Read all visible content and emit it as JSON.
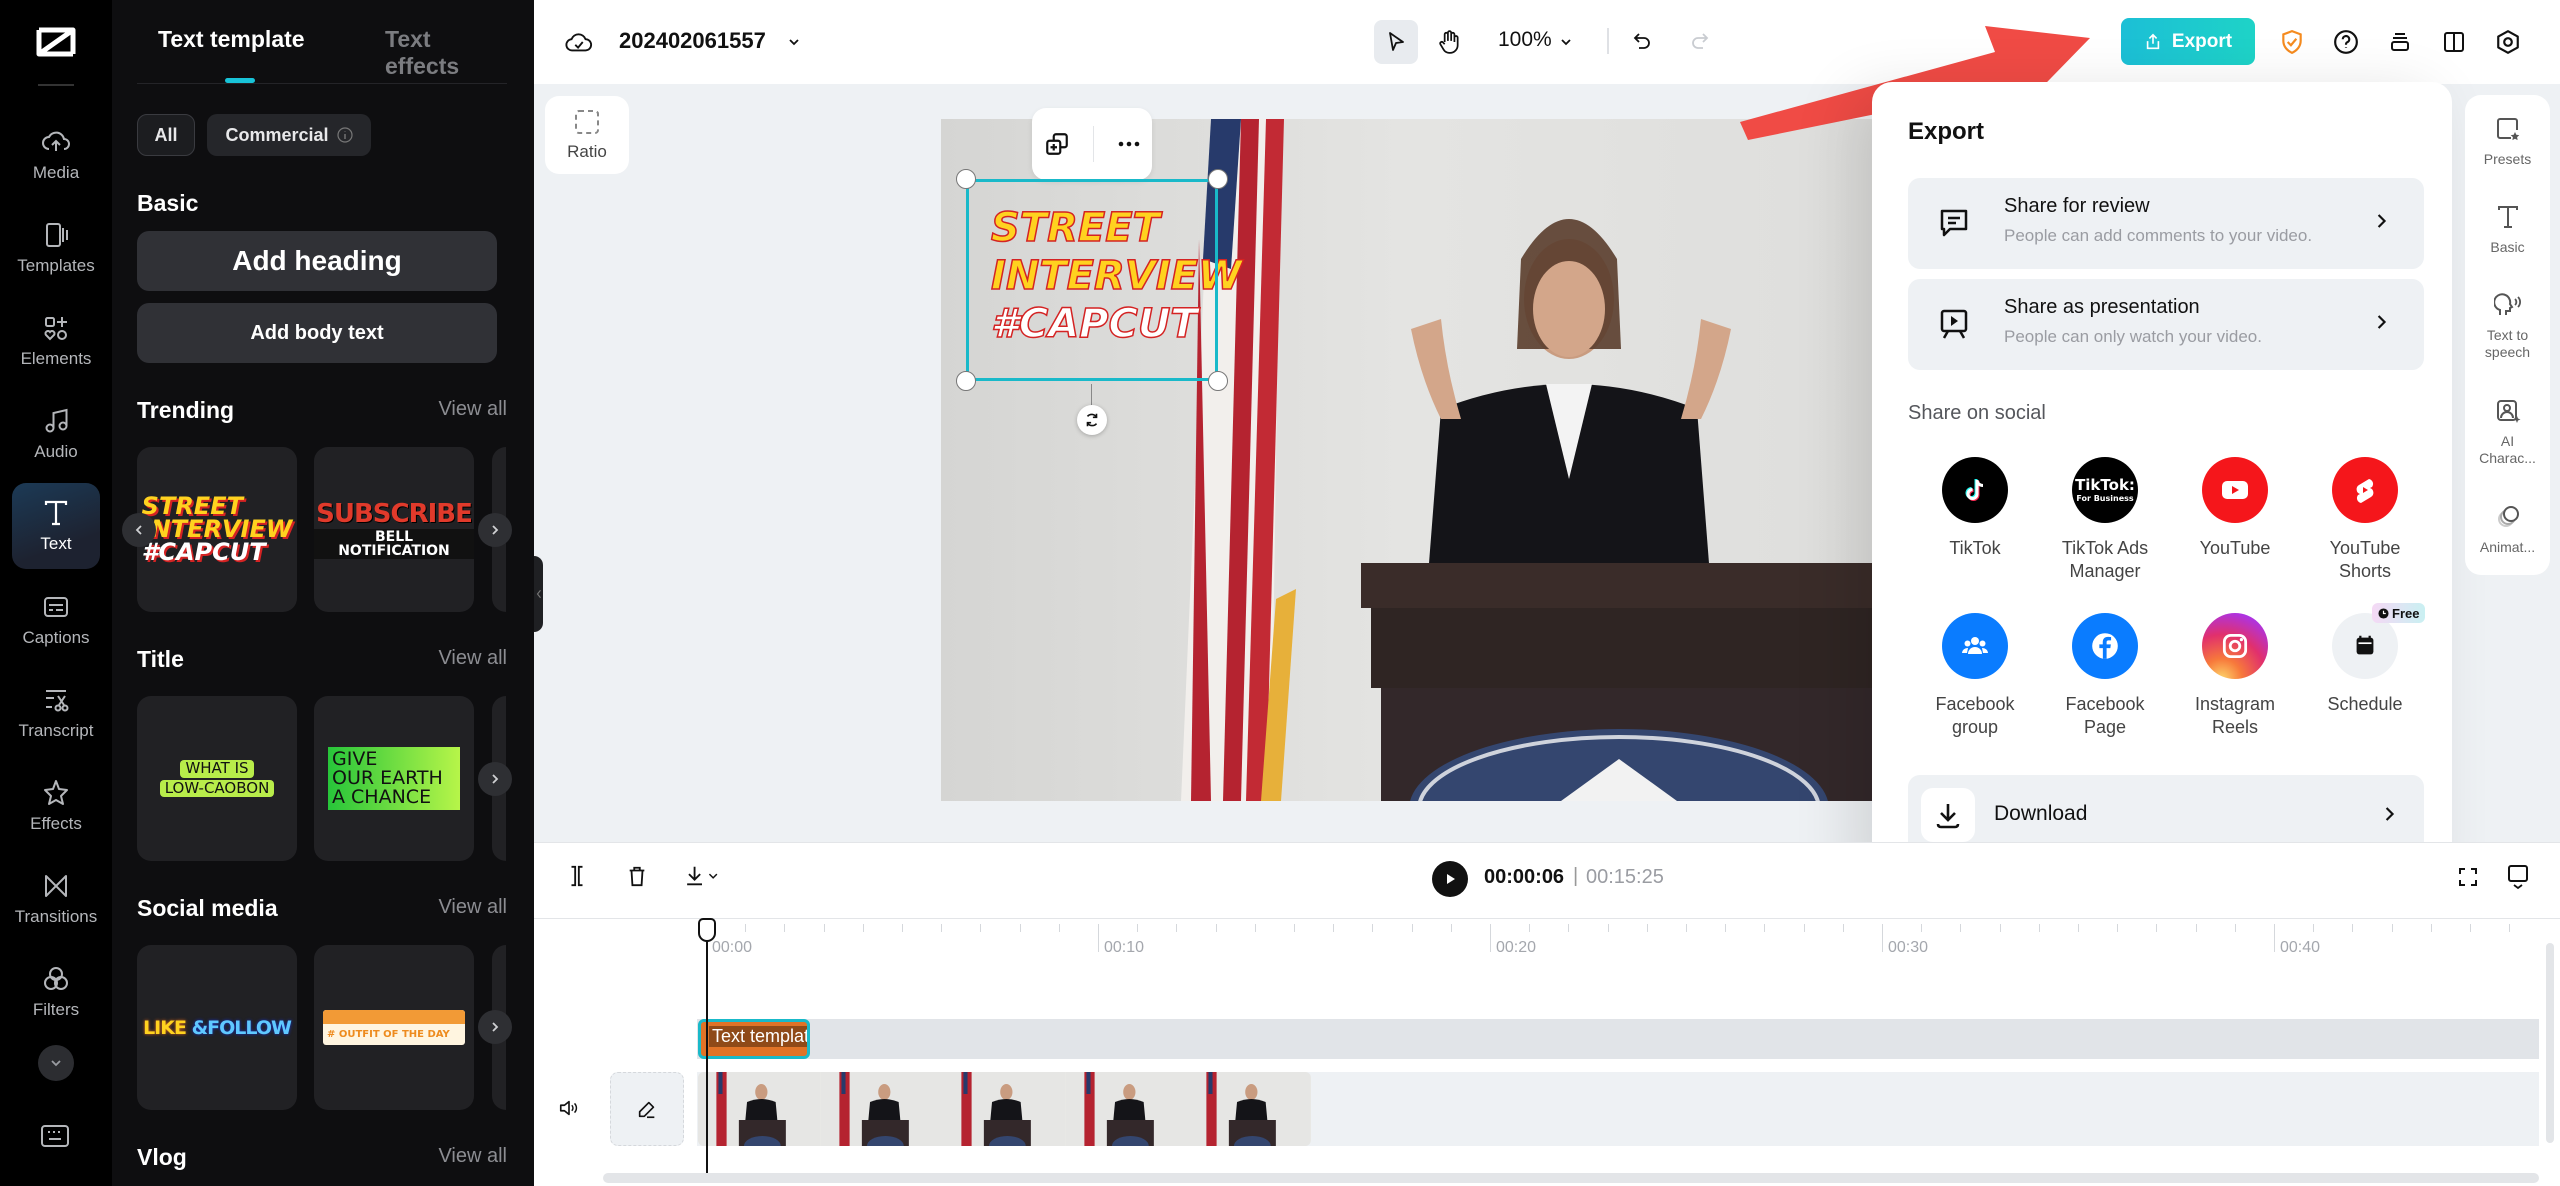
{
  "app": {
    "brand": "CapCut"
  },
  "rail": {
    "items": [
      {
        "label": "Media",
        "icon": "cloud-upload-icon"
      },
      {
        "label": "Templates",
        "icon": "templates-icon"
      },
      {
        "label": "Elements",
        "icon": "elements-icon"
      },
      {
        "label": "Audio",
        "icon": "music-note-icon"
      },
      {
        "label": "Text",
        "icon": "text-icon",
        "active": true
      },
      {
        "label": "Captions",
        "icon": "captions-icon"
      },
      {
        "label": "Transcript",
        "icon": "transcript-icon"
      },
      {
        "label": "Effects",
        "icon": "effects-icon"
      },
      {
        "label": "Transitions",
        "icon": "transitions-icon"
      },
      {
        "label": "Filters",
        "icon": "filters-icon"
      }
    ]
  },
  "panel": {
    "tabs": [
      {
        "label": "Text template",
        "active": true
      },
      {
        "label": "Text effects",
        "active": false
      }
    ],
    "filters": {
      "all": "All",
      "commercial": "Commercial"
    },
    "basic": {
      "title": "Basic",
      "add_heading": "Add heading",
      "add_body": "Add body text"
    },
    "view_all": "View all",
    "sections": [
      {
        "title": "Trending",
        "cards": [
          {
            "lines": [
              "STREET",
              "INTERVIEW",
              "#CAPCUT"
            ]
          },
          {
            "lines": [
              "SUBSCRIBE",
              "BELL NOTIFICATION"
            ]
          }
        ]
      },
      {
        "title": "Title",
        "cards": [
          {
            "lines": [
              "WHAT IS",
              "LOW-CAOBON"
            ]
          },
          {
            "lines": [
              "GIVE",
              "OUR EARTH",
              "A CHANCE"
            ]
          }
        ]
      },
      {
        "title": "Social media",
        "cards": [
          {
            "lines": [
              "LIKE",
              "&FOLLOW"
            ]
          },
          {
            "lines": [
              "# OUTFIT OF THE DAY"
            ]
          }
        ]
      },
      {
        "title": "Vlog",
        "cards": []
      }
    ]
  },
  "topbar": {
    "project_name": "202402061557",
    "zoom": "100%",
    "export_label": "Export"
  },
  "canvas": {
    "ratio_label": "Ratio",
    "overlay_text": [
      "STREET",
      "INTERVIEW",
      "#CAPCUT"
    ]
  },
  "export_panel": {
    "title": "Export",
    "share_review": {
      "title": "Share for review",
      "subtitle": "People can add comments to your video."
    },
    "share_presentation": {
      "title": "Share as presentation",
      "subtitle": "People can only watch your video."
    },
    "share_on_social": "Share on social",
    "socials": [
      {
        "label": "TikTok",
        "color": "#000000"
      },
      {
        "label": "TikTok Ads Manager",
        "color": "#000000"
      },
      {
        "label": "YouTube",
        "color": "#f5161b"
      },
      {
        "label": "YouTube Shorts",
        "color": "#f5161b"
      },
      {
        "label": "Facebook group",
        "color": "#0a7cff"
      },
      {
        "label": "Facebook Page",
        "color": "#0a7cff"
      },
      {
        "label": "Instagram Reels",
        "color": "#e4405f"
      },
      {
        "label": "Schedule",
        "color": "#eef1f4",
        "badge": "Free"
      }
    ],
    "tiktok_business_line1": "TikTok:",
    "tiktok_business_line2": "For Business",
    "download": "Download"
  },
  "props": [
    {
      "label": "Presets"
    },
    {
      "label": "Basic"
    },
    {
      "label": "Text to speech"
    },
    {
      "label": "AI Charac..."
    },
    {
      "label": "Animat..."
    }
  ],
  "timeline": {
    "current_time": "00:00:06",
    "separator": "|",
    "total_time": "00:15:25",
    "ruler_labels": [
      "00:00",
      "00:10",
      "00:20",
      "00:30",
      "00:40"
    ],
    "text_clip_label": "Text template"
  },
  "colors": {
    "accent": "#19b9c9",
    "export_gradient_start": "#1cbfd6",
    "export_gradient_end": "#1ed3c7",
    "annotation_arrow": "#f04b45"
  }
}
